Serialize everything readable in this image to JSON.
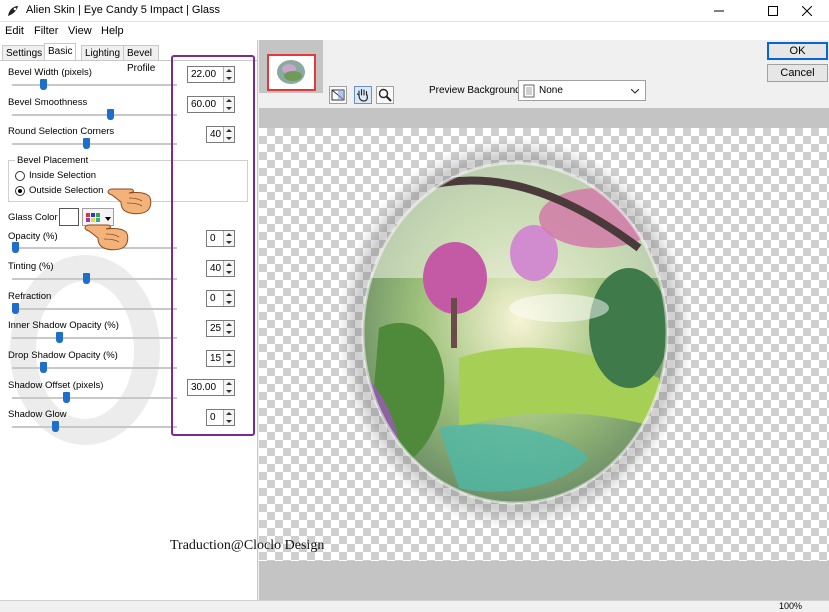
{
  "window": {
    "title": "Alien Skin | Eye Candy 5 Impact | Glass",
    "icons": [
      "app-icon",
      "minimize-icon",
      "maximize-icon",
      "close-icon"
    ]
  },
  "menu": [
    "Edit",
    "Filter",
    "View",
    "Help"
  ],
  "tabs": [
    "Settings",
    "Basic",
    "Lighting",
    "Bevel Profile"
  ],
  "active_tab": "Basic",
  "params": {
    "bevel_width": {
      "label": "Bevel Width (pixels)",
      "value": "22.00",
      "level": 0.18
    },
    "bevel_smoothness": {
      "label": "Bevel Smoothness",
      "value": "60.00",
      "level": 0.6
    },
    "round_corners": {
      "label": "Round Selection Corners",
      "value": "40",
      "level": 0.45
    },
    "opacity": {
      "label": "Opacity (%)",
      "value": "0",
      "level": 0.0
    },
    "tinting": {
      "label": "Tinting (%)",
      "value": "40",
      "level": 0.45
    },
    "refraction": {
      "label": "Refraction",
      "value": "0",
      "level": 0.0
    },
    "inner_shadow": {
      "label": "Inner Shadow Opacity (%)",
      "value": "25",
      "level": 0.28
    },
    "drop_shadow": {
      "label": "Drop Shadow Opacity (%)",
      "value": "15",
      "level": 0.18
    },
    "shadow_offset": {
      "label": "Shadow Offset (pixels)",
      "value": "30.00",
      "level": 0.32
    },
    "shadow_glow": {
      "label": "Shadow Glow",
      "value": "0",
      "level": 0.25
    }
  },
  "bevel_placement": {
    "title": "Bevel Placement",
    "inside": "Inside Selection",
    "outside": "Outside Selection",
    "selected": "outside"
  },
  "glass_color": {
    "label": "Glass Color",
    "color": "#ffffff"
  },
  "preview_background": {
    "label": "Preview Background:",
    "value": "None"
  },
  "buttons": {
    "ok": "OK",
    "cancel": "Cancel"
  },
  "credit": "Traduction@Cloclo Design",
  "zoom": "100%",
  "colors": {
    "accent": "#1e6fcc",
    "highlight_box": "#7b2a93",
    "thumb_border": "#e23a3a"
  }
}
